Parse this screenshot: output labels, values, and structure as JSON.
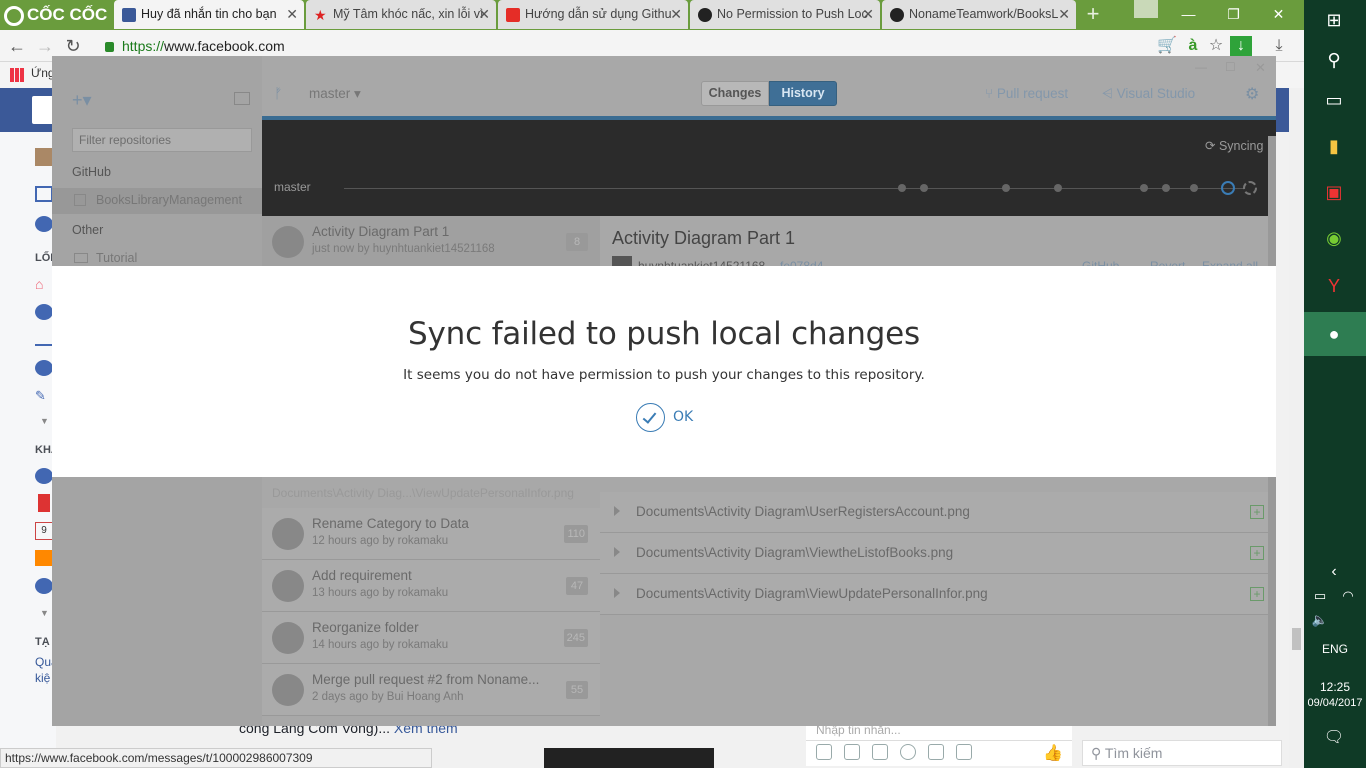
{
  "browser": {
    "logo": "CỐC CỐC",
    "tabs": [
      {
        "label": "Huy đã nhắn tin cho bạn",
        "active": true
      },
      {
        "label": "Mỹ Tâm khóc nấc, xin lỗi vì",
        "active": false
      },
      {
        "label": "Hướng dẫn sử dụng Githu",
        "active": false
      },
      {
        "label": "No Permission to Push Loc",
        "active": false
      },
      {
        "label": "NonameTeamwork/BooksL",
        "active": false
      }
    ],
    "url_scheme": "https://",
    "url_host": "www.facebook.com",
    "bookmarks_label": "Ứng",
    "status_url": "https://www.facebook.com/messages/t/100002986007309"
  },
  "facebook": {
    "side_labels": [
      "LỐI",
      "KHÁ",
      "TẠ"
    ],
    "side_links": "Quả kiệ",
    "calendar_day": "9",
    "post_text": "cong Lang Com Vong)...",
    "post_more": "Xem thêm",
    "chat_placeholder": "Nhập tin nhắn...",
    "search_placeholder": "Tìm kiếm"
  },
  "github_desktop": {
    "sidebar": {
      "filter_placeholder": "Filter repositories",
      "group_github": "GitHub",
      "repo_active": "BooksLibraryManagement",
      "group_other": "Other",
      "repo_other": "Tutorial"
    },
    "toolbar": {
      "branch": "master",
      "tab_changes": "Changes",
      "tab_history": "History",
      "pull_request": "Pull request",
      "visual_studio": "Visual Studio"
    },
    "timeline": {
      "branch_label": "master",
      "sync_label": "Syncing"
    },
    "commits": [
      {
        "title": "Activity Diagram Part 1",
        "sub": "just now by huynhtuankiet14521168",
        "badge": "8"
      },
      {
        "title": "Rename Category to Data",
        "sub": "12 hours ago by rokamaku",
        "badge": "110"
      },
      {
        "title": "Add requirement",
        "sub": "13 hours ago by rokamaku",
        "badge": "47"
      },
      {
        "title": "Reorganize folder",
        "sub": "14 hours ago by rokamaku",
        "badge": "245"
      },
      {
        "title": "Merge pull request #2 from Noname...",
        "sub": "2 days ago by Bui Hoang Anh",
        "badge": "55"
      }
    ],
    "partial_file": "Documents\\Activity Diag...\\ViewUpdatePersonalInfor.png",
    "detail": {
      "title": "Activity Diagram Part 1",
      "author": "huynhtuankiet14521168",
      "sha": "fe078d4",
      "link_github": "GitHub",
      "link_revert": "Revert",
      "link_expand": "Expand all"
    },
    "files": [
      "Documents\\Activity Diagram\\UserRegistersAccount.png",
      "Documents\\Activity Diagram\\ViewtheListofBooks.png",
      "Documents\\Activity Diagram\\ViewUpdatePersonalInfor.png"
    ]
  },
  "modal": {
    "title": "Sync failed to push local changes",
    "message": "It seems you do not have permission to push your changes to this repository.",
    "ok_label": "OK"
  },
  "taskbar": {
    "language": "ENG",
    "time": "12:25",
    "date": "09/04/2017"
  }
}
